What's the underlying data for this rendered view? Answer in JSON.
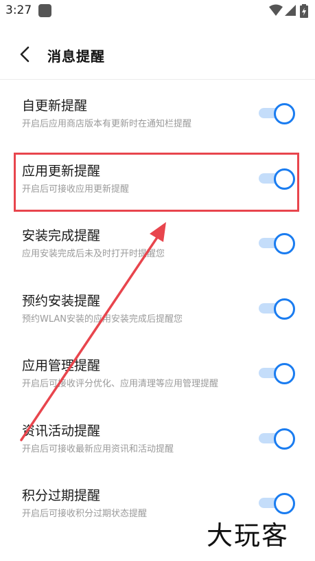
{
  "status_bar": {
    "time": "3:27"
  },
  "header": {
    "title": "消息提醒"
  },
  "settings": [
    {
      "title": "自更新提醒",
      "subtitle": "开启后应用商店版本有更新时在通知栏提醒",
      "enabled": true
    },
    {
      "title": "应用更新提醒",
      "subtitle": "开启后可接收应用更新提醒",
      "enabled": true
    },
    {
      "title": "安装完成提醒",
      "subtitle": "应用安装完成后未及时打开时提醒您",
      "enabled": true
    },
    {
      "title": "预约安装提醒",
      "subtitle": "预约WLAN安装的应用安装完成后提醒您",
      "enabled": true
    },
    {
      "title": "应用管理提醒",
      "subtitle": "开启后可接收评分优化、应用清理等应用管理提醒",
      "enabled": true
    },
    {
      "title": "资讯活动提醒",
      "subtitle": "开启后可接收最新应用资讯和活动提醒",
      "enabled": true
    },
    {
      "title": "积分过期提醒",
      "subtitle": "开启后可接收积分过期状态提醒",
      "enabled": true
    }
  ],
  "watermark": "大玩客",
  "colors": {
    "accent": "#1a7cf0",
    "track": "#c4ddfa",
    "highlight": "#e8454d"
  }
}
